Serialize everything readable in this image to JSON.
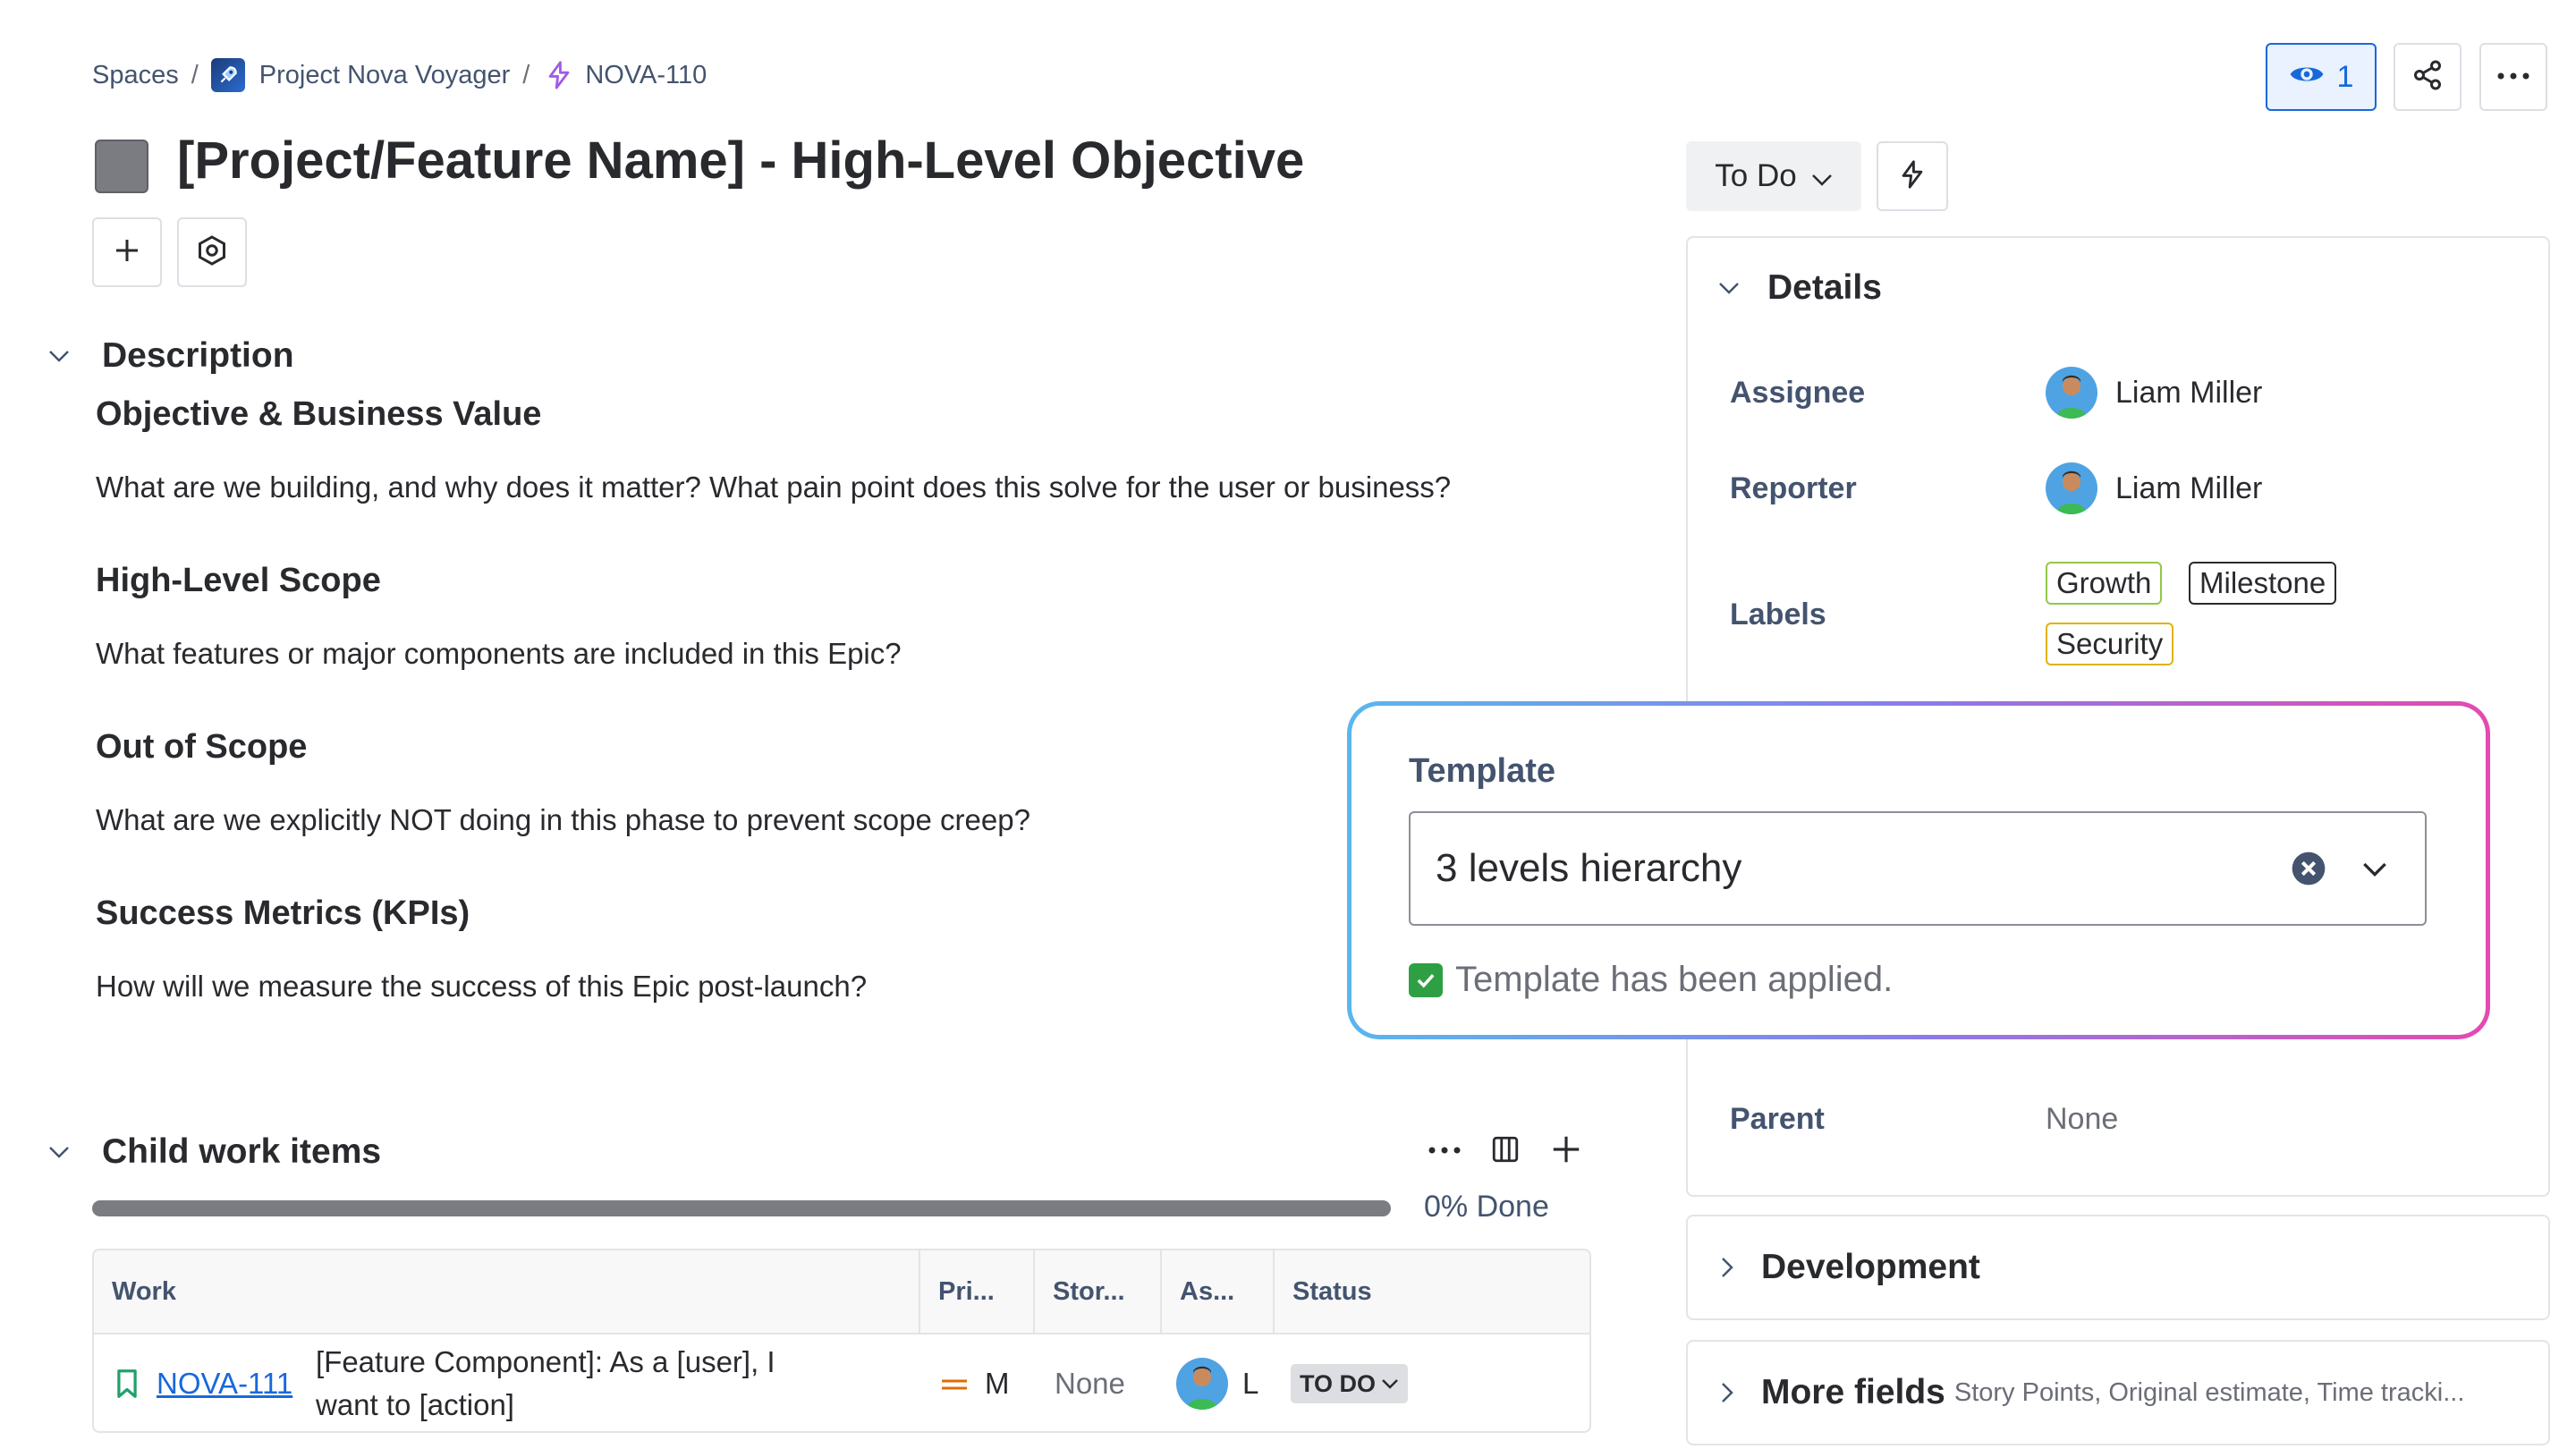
{
  "breadcrumb": {
    "spaces": "Spaces",
    "separator": "/",
    "project": "Project Nova Voyager",
    "issue_key": "NOVA-110"
  },
  "header": {
    "watch_count": "1",
    "title": "[Project/Feature Name] - High-Level Objective"
  },
  "status": {
    "label": "To Do"
  },
  "description": {
    "heading": "Description",
    "blocks": [
      {
        "heading": "Objective & Business Value",
        "text": "What are we building, and why does it matter? What pain point does this solve for the user or business?"
      },
      {
        "heading": "High-Level Scope",
        "text": "What features or major components are included in this Epic?"
      },
      {
        "heading": "Out of Scope",
        "text": "What are we explicitly NOT doing in this phase to prevent scope creep?"
      },
      {
        "heading": "Success Metrics (KPIs)",
        "text": "How will we measure the success of this Epic post-launch?"
      }
    ]
  },
  "details": {
    "heading": "Details",
    "assignee_label": "Assignee",
    "assignee": "Liam Miller",
    "reporter_label": "Reporter",
    "reporter": "Liam Miller",
    "labels_label": "Labels",
    "labels": [
      "Growth",
      "Milestone",
      "Security"
    ],
    "parent_label": "Parent",
    "parent": "None"
  },
  "template": {
    "label": "Template",
    "value": "3 levels hierarchy",
    "confirmation": "Template has been applied."
  },
  "development": {
    "title": "Development"
  },
  "more_fields": {
    "title": "More fields",
    "subtitle": "Story Points, Original estimate, Time tracki..."
  },
  "child_items": {
    "heading": "Child work items",
    "progress_label": "0% Done",
    "progress_fraction": 0,
    "columns": [
      "Work",
      "Pri...",
      "Stor...",
      "As...",
      "Status"
    ],
    "rows": [
      {
        "key": "NOVA-111",
        "summary_line1": "[Feature Component]: As a [user], I",
        "summary_line2": "want to [action]",
        "priority": "M",
        "story_points": "None",
        "assignee": "L",
        "status": "TO DO"
      }
    ]
  },
  "colors": {
    "link_blue": "#1868db",
    "epic_gray": "#7a7c82",
    "check_green": "#2ea043",
    "label_growth_border": "#94c748",
    "label_milestone_border": "#292a2e",
    "label_security_border": "#e2b203"
  }
}
